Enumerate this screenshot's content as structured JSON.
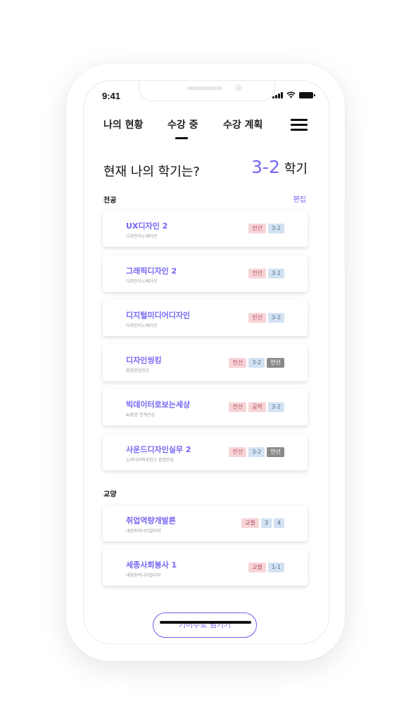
{
  "status_bar": {
    "time": "9:41"
  },
  "tabs": [
    {
      "label": "나의 현황"
    },
    {
      "label": "수강 중"
    },
    {
      "label": "수강 계획"
    }
  ],
  "active_tab": "수강 중",
  "headline": "현재 나의 학기는?",
  "semester": {
    "value": "3-2",
    "unit": "학기"
  },
  "major": {
    "title": "전공",
    "edit_label": "편집",
    "courses": [
      {
        "name": "UX디자인 2",
        "dept": "디자인이노베이션",
        "badges": [
          {
            "text": "전선",
            "tone": "red"
          },
          {
            "text": "3-2",
            "tone": "blue"
          }
        ]
      },
      {
        "name": "그래픽디자인 2",
        "dept": "디자인이노베이션",
        "badges": [
          {
            "text": "전선",
            "tone": "red"
          },
          {
            "text": "3-2",
            "tone": "blue"
          }
        ]
      },
      {
        "name": "디지털미디어디자인",
        "dept": "디자인이노베이션",
        "badges": [
          {
            "text": "전선",
            "tone": "red"
          },
          {
            "text": "3-2",
            "tone": "blue"
          }
        ]
      },
      {
        "name": "디자인씽킹",
        "dept": "융합창업전공",
        "badges": [
          {
            "text": "전선",
            "tone": "red"
          },
          {
            "text": "3-2",
            "tone": "blue"
          },
          {
            "text": "연선",
            "tone": "gray"
          }
        ]
      },
      {
        "name": "빅데이터로보는세상",
        "dept": "AI융합 연계전공",
        "badges": [
          {
            "text": "전선",
            "tone": "red"
          },
          {
            "text": "공학",
            "tone": "red"
          },
          {
            "text": "3-2",
            "tone": "blue"
          }
        ]
      },
      {
        "name": "사운드디자인실무 2",
        "dept": "뉴미디어퍼포먼스 융합전공",
        "badges": [
          {
            "text": "전선",
            "tone": "red"
          },
          {
            "text": "3-2",
            "tone": "blue"
          },
          {
            "text": "연선",
            "tone": "gray"
          }
        ]
      }
    ]
  },
  "liberal": {
    "title": "교양",
    "courses": [
      {
        "name": "취업역량개발론",
        "dept": "대양휴머니티칼리지",
        "badges": [
          {
            "text": "교필",
            "tone": "red"
          },
          {
            "text": "3",
            "tone": "blue"
          },
          {
            "text": "4",
            "tone": "blue"
          }
        ]
      },
      {
        "name": "세종사회봉사 1",
        "dept": "대양휴머니티칼리지",
        "badges": [
          {
            "text": "교필",
            "tone": "red"
          },
          {
            "text": "1-1",
            "tone": "blue"
          }
        ]
      }
    ]
  },
  "bottom_button": "기이수로 넘기기",
  "colors": {
    "accent": "#7466f5",
    "badge_red": "#f7d4d8",
    "badge_blue": "#d3e2f2",
    "badge_gray": "#8a8a8a"
  }
}
